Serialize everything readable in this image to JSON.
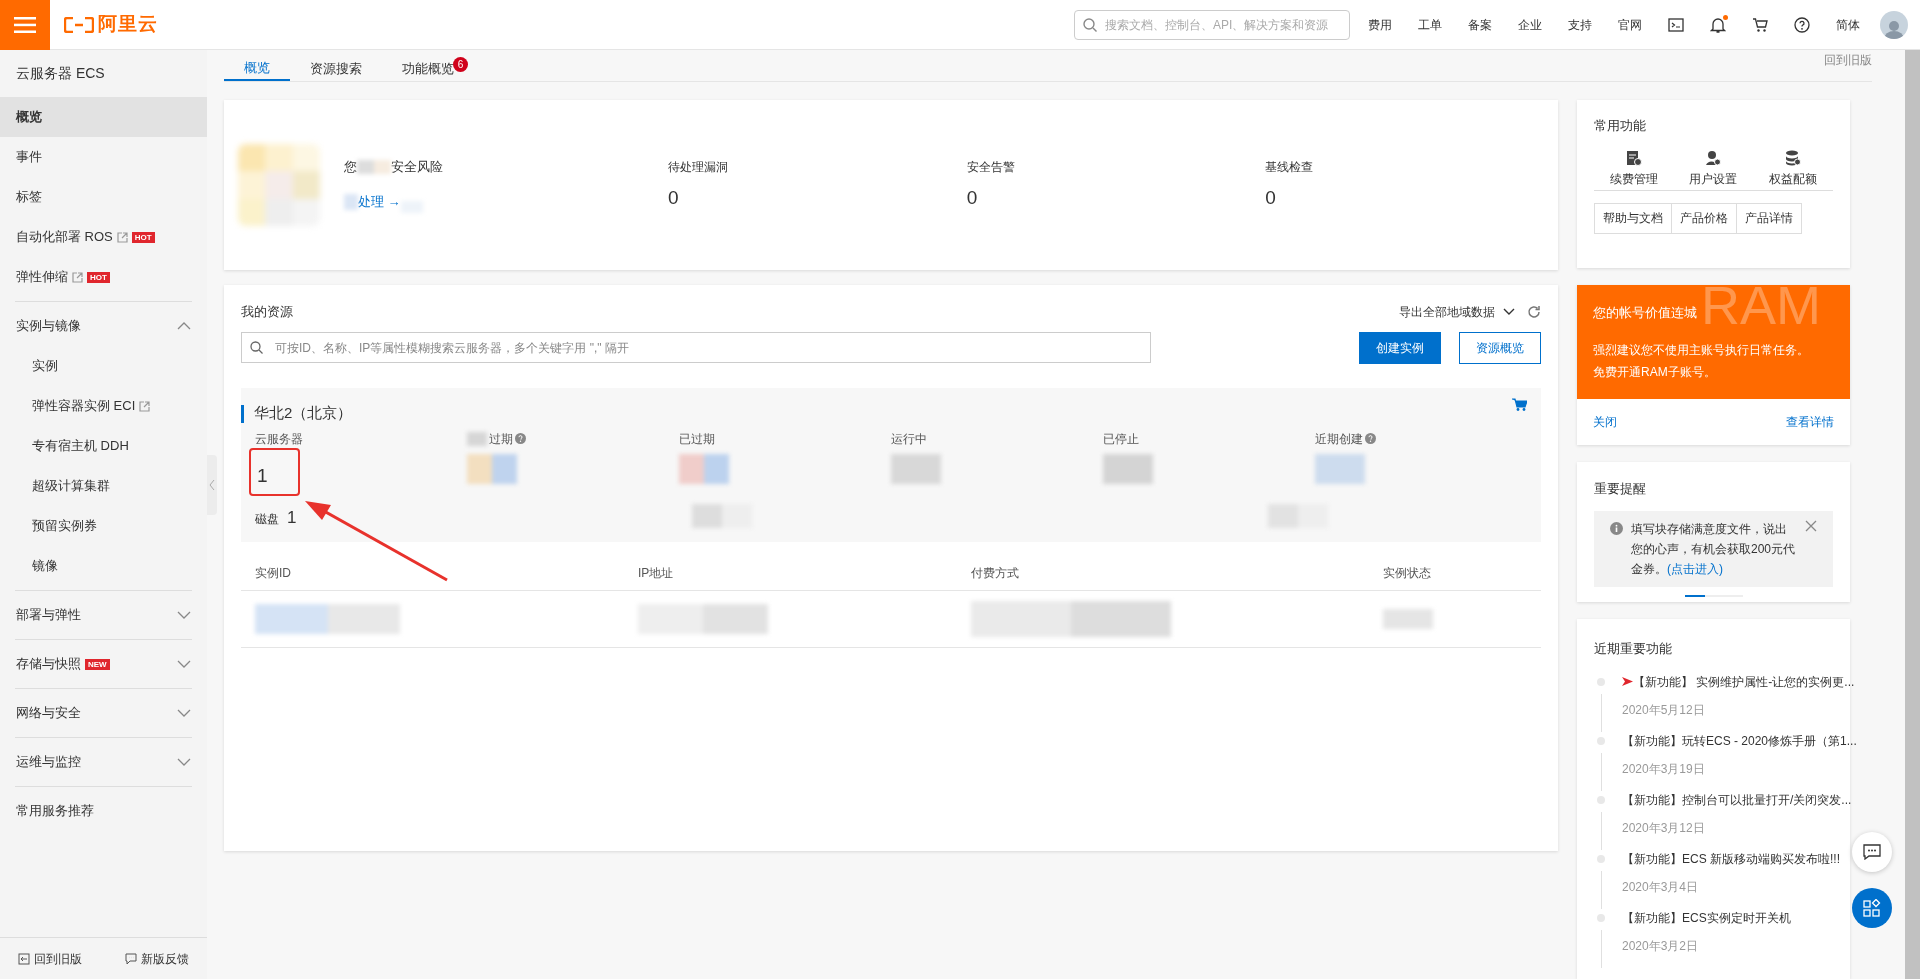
{
  "topbar": {
    "brand": "阿里云",
    "search": {
      "placeholder": "搜索文档、控制台、API、解决方案和资源"
    },
    "nav": [
      "费用",
      "工单",
      "备案",
      "企业",
      "支持",
      "官网"
    ],
    "notification": true,
    "language": "简体"
  },
  "sidebar": {
    "title": "云服务器 ECS",
    "items": [
      {
        "kind": "link",
        "label": "概览",
        "selected": true
      },
      {
        "kind": "link",
        "label": "事件",
        "selected": false
      },
      {
        "kind": "link",
        "label": "标签",
        "selected": false
      },
      {
        "kind": "link",
        "label": "自动化部署 ROS",
        "selected": false,
        "external": true,
        "badge": "HOT"
      },
      {
        "kind": "link",
        "label": "弹性伸缩",
        "selected": false,
        "external": true,
        "badge": "HOT"
      },
      {
        "kind": "group",
        "label": "实例与镜像",
        "selected": false,
        "expanded": true,
        "children": [
          {
            "label": "实例",
            "selected": false
          },
          {
            "label": "弹性容器实例 ECI",
            "selected": false,
            "external": true
          },
          {
            "label": "专有宿主机 DDH",
            "selected": false
          },
          {
            "label": "超级计算集群",
            "selected": false
          },
          {
            "label": "预留实例券",
            "selected": false
          },
          {
            "label": "镜像",
            "selected": false
          }
        ]
      },
      {
        "kind": "group",
        "label": "部署与弹性",
        "selected": false,
        "expanded": false
      },
      {
        "kind": "group",
        "label": "存储与快照",
        "selected": false,
        "expanded": false,
        "badge": "NEW"
      },
      {
        "kind": "group",
        "label": "网络与安全",
        "selected": false,
        "expanded": false
      },
      {
        "kind": "group",
        "label": "运维与监控",
        "selected": false,
        "expanded": false
      },
      {
        "kind": "section",
        "label": "常用服务推荐",
        "selected": false
      }
    ],
    "footer": [
      "回到旧版",
      "新版反馈"
    ]
  },
  "tabs": [
    {
      "label": "概览",
      "selected": true
    },
    {
      "label": "资源搜索",
      "selected": false
    },
    {
      "label": "功能概览",
      "selected": false,
      "badge": "6"
    }
  ],
  "back_link": "回到旧版",
  "security": {
    "prefix": "您",
    "suffix": "安全风险",
    "action": "处理 →",
    "stats": [
      {
        "label": "待处理漏洞",
        "value": "0"
      },
      {
        "label": "安全告警",
        "value": "0"
      },
      {
        "label": "基线检查",
        "value": "0"
      }
    ]
  },
  "resources": {
    "title": "我的资源",
    "export": "导出全部地域数据",
    "search": {
      "placeholder": "可按ID、名称、IP等属性模糊搜索云服务器，多个关键字用 \",\" 隔开"
    },
    "buttons": [
      {
        "label": "创建实例",
        "kind": "primary"
      },
      {
        "label": "资源概览",
        "kind": "outline"
      }
    ],
    "region": {
      "name": "华北2（北京）",
      "stats": [
        {
          "label": "云服务器",
          "value": "1",
          "help": false
        },
        {
          "label": "过期",
          "help": true
        },
        {
          "label": "已过期",
          "help": false
        },
        {
          "label": "运行中",
          "help": false
        },
        {
          "label": "已停止",
          "help": false
        },
        {
          "label": "近期创建",
          "help": true
        }
      ],
      "disk": {
        "label": "磁盘",
        "value": "1"
      }
    },
    "table": {
      "columns": [
        "实例ID",
        "IP地址",
        "付费方式",
        "实例状态"
      ]
    }
  },
  "quick": {
    "title": "常用功能",
    "shortcuts": [
      {
        "label": "续费管理",
        "kind": "renew"
      },
      {
        "label": "用户设置",
        "kind": "user"
      },
      {
        "label": "权益配额",
        "kind": "quota"
      }
    ],
    "links": [
      "帮助与文档",
      "产品价格",
      "产品详情"
    ]
  },
  "banner": {
    "title": "您的帐号价值连城",
    "lines": [
      "强烈建议您不使用主账号执行日常任务。",
      "免费开通RAM子账号。"
    ],
    "background_text": "RAM",
    "actions": [
      "关闭",
      "查看详情"
    ]
  },
  "reminder": {
    "title": "重要提醒",
    "text": "填写块存储满意度文件，说出您的心声，有机会获取200元代金券。",
    "link": "(点击进入)"
  },
  "news": {
    "title": "近期重要功能",
    "items": [
      {
        "title": "【新功能】 实例维护属性-让您的实例更...",
        "date": "2020年5月12日",
        "highlight": true
      },
      {
        "title": "【新功能】玩转ECS - 2020修炼手册（第1...",
        "date": "2020年3月19日",
        "highlight": false
      },
      {
        "title": "【新功能】控制台可以批量打开/关闭突发...",
        "date": "2020年3月12日",
        "highlight": false
      },
      {
        "title": "【新功能】ECS 新版移动端购买发布啦!!!",
        "date": "2020年3月4日",
        "highlight": false
      },
      {
        "title": "【新功能】ECS实例定时开关机",
        "date": "2020年3月2日",
        "highlight": false
      }
    ]
  }
}
